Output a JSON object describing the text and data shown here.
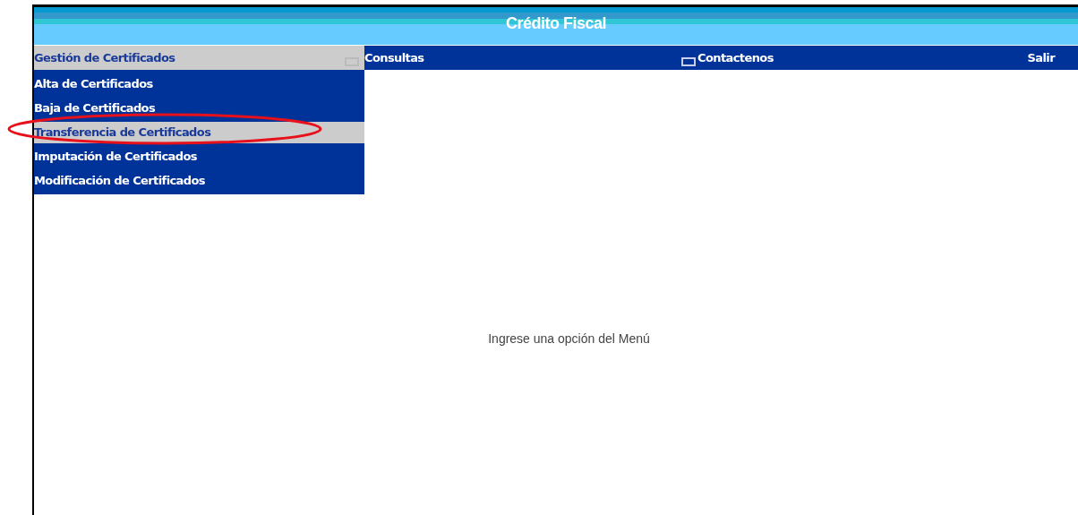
{
  "window": {
    "title": "Crédito Fiscal"
  },
  "menu": [
    {
      "label": "Gestión de Certificados",
      "selected": true,
      "icon": true
    },
    {
      "label": "Consultas",
      "selected": false,
      "icon": false
    },
    {
      "label": "Contactenos",
      "selected": false,
      "icon": true
    },
    {
      "label": "Salir",
      "selected": false,
      "icon": false
    }
  ],
  "submenu": [
    {
      "label": "Alta de Certificados",
      "selected": false,
      "circled": false
    },
    {
      "label": "Baja de Certificados",
      "selected": false,
      "circled": false
    },
    {
      "label": "Transferencia de Certificados",
      "selected": true,
      "circled": true
    },
    {
      "label": "Imputación de Certificados",
      "selected": false,
      "circled": false
    },
    {
      "label": "Modificación de Certificados",
      "selected": false,
      "circled": false
    }
  ],
  "message": "Ingrese una opción del Menú"
}
